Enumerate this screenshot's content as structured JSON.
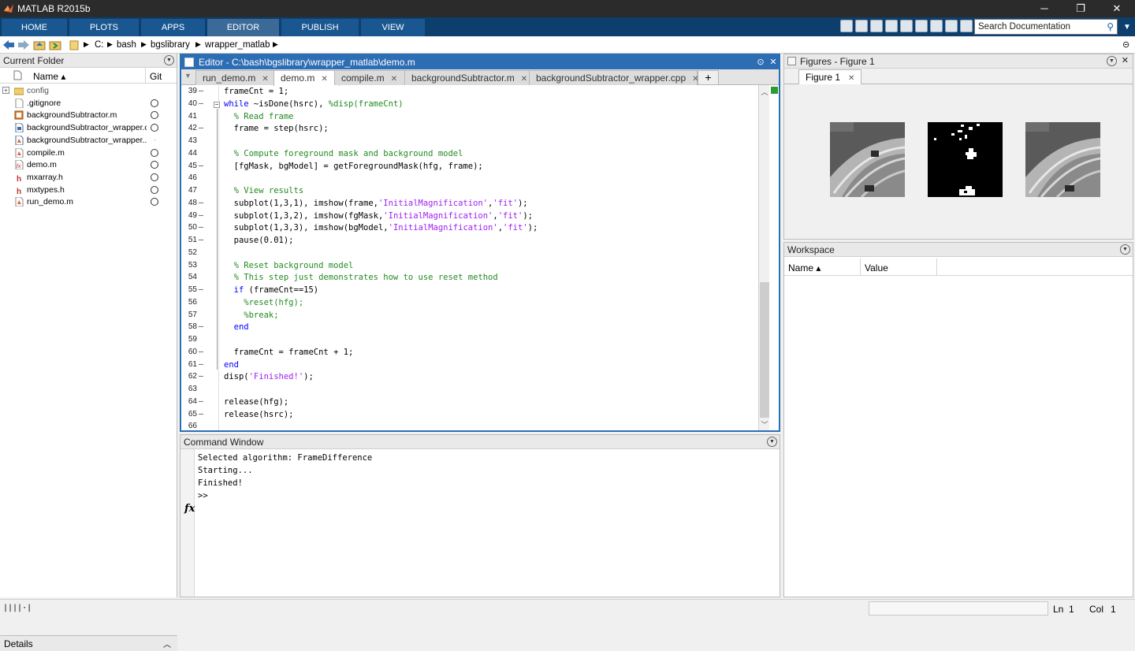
{
  "window": {
    "title": "MATLAB R2015b",
    "minimize": "─",
    "maximize": "❐",
    "close": "✕"
  },
  "ribbon": {
    "tabs": [
      "HOME",
      "PLOTS",
      "APPS",
      "EDITOR",
      "PUBLISH",
      "VIEW"
    ],
    "active_tab": "EDITOR"
  },
  "search": {
    "placeholder": "Search Documentation"
  },
  "address": {
    "path": [
      "C:",
      "bash",
      "bgslibrary",
      "wrapper_matlab"
    ]
  },
  "current_folder": {
    "title": "Current Folder",
    "col_name": "Name ▴",
    "col_git": "Git",
    "files": [
      {
        "name": "config",
        "icon": "folder-icon",
        "git": "none",
        "color": "#555555"
      },
      {
        "name": ".gitignore",
        "icon": "file-icon",
        "git": "circle"
      },
      {
        "name": "backgroundSubtractor.m",
        "icon": "class-file-icon",
        "git": "circle"
      },
      {
        "name": "backgroundSubtractor_wrapper.c...",
        "icon": "cpp-file-icon",
        "git": "circle"
      },
      {
        "name": "backgroundSubtractor_wrapper....",
        "icon": "mex-file-icon",
        "git": "dot"
      },
      {
        "name": "compile.m",
        "icon": "script-file-icon",
        "git": "circle"
      },
      {
        "name": "demo.m",
        "icon": "function-file-icon",
        "git": "circle"
      },
      {
        "name": "mxarray.h",
        "icon": "header-file-icon",
        "git": "circle"
      },
      {
        "name": "mxtypes.h",
        "icon": "header-file-icon",
        "git": "circle"
      },
      {
        "name": "run_demo.m",
        "icon": "script-file-icon",
        "git": "circle"
      }
    ],
    "details": "Details"
  },
  "editor": {
    "title": "Editor - C:\\bash\\bgslibrary\\wrapper_matlab\\demo.m",
    "tabs": [
      "run_demo.m",
      "demo.m",
      "compile.m",
      "backgroundSubtractor.m",
      "backgroundSubtractor_wrapper.cpp"
    ],
    "active_tab": "demo.m",
    "lines": [
      {
        "n": "39",
        "dash": true,
        "seg": [
          [
            "",
            "frameCnt = 1;"
          ]
        ]
      },
      {
        "n": "40",
        "dash": true,
        "fold": "⊟",
        "seg": [
          [
            "kw",
            "while"
          ],
          [
            "",
            " ~isDone(hsrc), "
          ],
          [
            "cm",
            "%disp(frameCnt)"
          ]
        ]
      },
      {
        "n": "41",
        "dash": false,
        "seg": [
          [
            "cm",
            "  % Read frame"
          ]
        ]
      },
      {
        "n": "42",
        "dash": true,
        "seg": [
          [
            "",
            "  frame = step(hsrc);"
          ]
        ]
      },
      {
        "n": "43",
        "dash": false,
        "seg": [
          [
            "",
            ""
          ]
        ]
      },
      {
        "n": "44",
        "dash": false,
        "seg": [
          [
            "cm",
            "  % Compute foreground mask and background model"
          ]
        ]
      },
      {
        "n": "45",
        "dash": true,
        "seg": [
          [
            "",
            "  [fgMask, bgModel] = getForegroundMask(hfg, frame);"
          ]
        ]
      },
      {
        "n": "46",
        "dash": false,
        "seg": [
          [
            "",
            ""
          ]
        ]
      },
      {
        "n": "47",
        "dash": false,
        "seg": [
          [
            "cm",
            "  % View results"
          ]
        ]
      },
      {
        "n": "48",
        "dash": true,
        "seg": [
          [
            "",
            "  subplot(1,3,1), imshow(frame,"
          ],
          [
            "str",
            "'InitialMagnification'"
          ],
          [
            "",
            ","
          ],
          [
            "str",
            "'fit'"
          ],
          [
            "",
            ");"
          ]
        ]
      },
      {
        "n": "49",
        "dash": true,
        "seg": [
          [
            "",
            "  subplot(1,3,2), imshow(fgMask,"
          ],
          [
            "str",
            "'InitialMagnification'"
          ],
          [
            "",
            ","
          ],
          [
            "str",
            "'fit'"
          ],
          [
            "",
            ");"
          ]
        ]
      },
      {
        "n": "50",
        "dash": true,
        "seg": [
          [
            "",
            "  subplot(1,3,3), imshow(bgModel,"
          ],
          [
            "str",
            "'InitialMagnification'"
          ],
          [
            "",
            ","
          ],
          [
            "str",
            "'fit'"
          ],
          [
            "",
            ");"
          ]
        ]
      },
      {
        "n": "51",
        "dash": true,
        "seg": [
          [
            "",
            "  pause(0.01);"
          ]
        ]
      },
      {
        "n": "52",
        "dash": false,
        "seg": [
          [
            "",
            ""
          ]
        ]
      },
      {
        "n": "53",
        "dash": false,
        "seg": [
          [
            "cm",
            "  % Reset background model"
          ]
        ]
      },
      {
        "n": "54",
        "dash": false,
        "seg": [
          [
            "cm",
            "  % This step just demonstrates how to use reset method"
          ]
        ]
      },
      {
        "n": "55",
        "dash": true,
        "seg": [
          [
            "kw",
            "  if"
          ],
          [
            "",
            " (frameCnt==15)"
          ]
        ]
      },
      {
        "n": "56",
        "dash": false,
        "seg": [
          [
            "cm",
            "    %reset(hfg);"
          ]
        ]
      },
      {
        "n": "57",
        "dash": false,
        "seg": [
          [
            "cm",
            "    %break;"
          ]
        ]
      },
      {
        "n": "58",
        "dash": true,
        "seg": [
          [
            "kw",
            "  end"
          ]
        ]
      },
      {
        "n": "59",
        "dash": false,
        "seg": [
          [
            "",
            ""
          ]
        ]
      },
      {
        "n": "60",
        "dash": true,
        "seg": [
          [
            "",
            "  frameCnt = frameCnt + 1;"
          ]
        ]
      },
      {
        "n": "61",
        "dash": true,
        "seg": [
          [
            "kw",
            "end"
          ]
        ]
      },
      {
        "n": "62",
        "dash": true,
        "seg": [
          [
            "",
            "disp("
          ],
          [
            "str",
            "'Finished!'"
          ],
          [
            "",
            ");"
          ]
        ]
      },
      {
        "n": "63",
        "dash": false,
        "seg": [
          [
            "",
            ""
          ]
        ]
      },
      {
        "n": "64",
        "dash": true,
        "seg": [
          [
            "",
            "release(hfg);"
          ]
        ]
      },
      {
        "n": "65",
        "dash": true,
        "seg": [
          [
            "",
            "release(hsrc);"
          ]
        ]
      },
      {
        "n": "66",
        "dash": false,
        "seg": [
          [
            "",
            ""
          ]
        ]
      }
    ]
  },
  "command_window": {
    "title": "Command Window",
    "lines": [
      "Selected algorithm: FrameDifference",
      "Starting...",
      "Finished!"
    ],
    "prompt": ">>",
    "fx": "fx"
  },
  "figures": {
    "title": "Figures - Figure 1",
    "tab": "Figure 1"
  },
  "workspace": {
    "title": "Workspace",
    "col_name": "Name ▴",
    "col_value": "Value"
  },
  "status": {
    "ln_label": "Ln",
    "ln": "1",
    "col_label": "Col",
    "col": "1",
    "busy": "||||·|"
  },
  "colors": {
    "ribbon": "#0c3f6e",
    "editor_border": "#2a6fb5",
    "keyword": "#0000ff",
    "string": "#a020f0",
    "comment": "#228b22"
  }
}
